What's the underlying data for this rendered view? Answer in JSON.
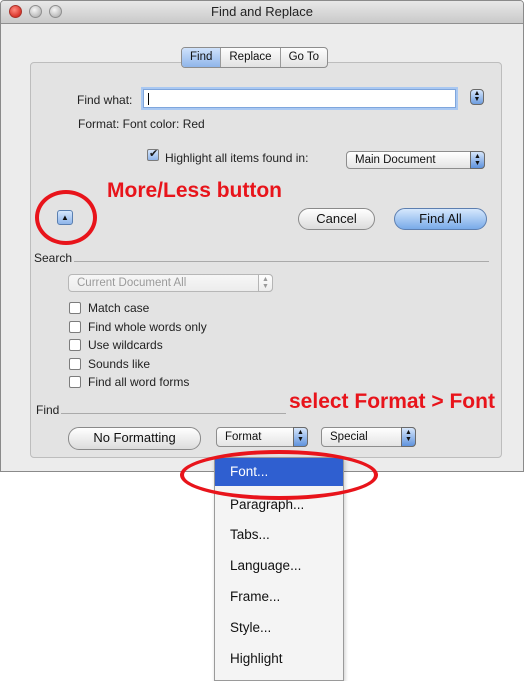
{
  "window": {
    "title": "Find and Replace"
  },
  "tabs": [
    {
      "label": "Find",
      "active": true
    },
    {
      "label": "Replace",
      "active": false
    },
    {
      "label": "Go To",
      "active": false
    }
  ],
  "find": {
    "label": "Find what:",
    "value": "",
    "format_text": "Format: Font color: Red",
    "highlight_label": "Highlight all items found in:",
    "highlight_checked": true,
    "scope_value": "Main Document"
  },
  "buttons": {
    "cancel": "Cancel",
    "find_all": "Find All",
    "no_formatting": "No Formatting"
  },
  "search_section": {
    "title": "Search",
    "scope_value": "Current Document All",
    "options": [
      {
        "label": "Match case",
        "checked": false
      },
      {
        "label": "Find whole words only",
        "checked": false
      },
      {
        "label": "Use wildcards",
        "checked": false
      },
      {
        "label": "Sounds like",
        "checked": false
      },
      {
        "label": "Find all word forms",
        "checked": false
      }
    ]
  },
  "find_section": {
    "title": "Find",
    "format_label": "Format",
    "special_label": "Special"
  },
  "format_menu": {
    "items": [
      "Font...",
      "Paragraph...",
      "Tabs...",
      "Language...",
      "Frame...",
      "Style...",
      "Highlight"
    ],
    "selected_index": 0
  },
  "annotations": {
    "more_less": "More/Less button",
    "select_font": "select Format > Font",
    "color": "#e8141b"
  },
  "colors": {
    "accent": "#2f5fd0",
    "window_bg": "#ececec"
  }
}
